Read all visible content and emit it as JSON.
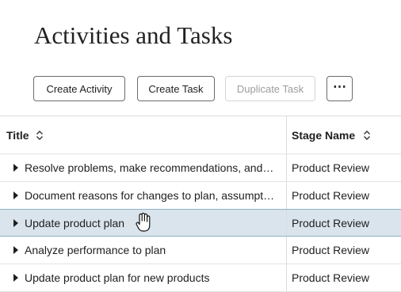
{
  "page": {
    "title": "Activities and Tasks"
  },
  "toolbar": {
    "create_activity": "Create Activity",
    "create_task": "Create Task",
    "duplicate_task": "Duplicate Task",
    "more": "⋯"
  },
  "table": {
    "columns": [
      "Title",
      "Stage Name"
    ],
    "rows": [
      {
        "title": "Resolve problems, make recommendations, and define sales goals",
        "stage": "Product Review",
        "selected": false
      },
      {
        "title": "Document reasons for changes to plan, assumptions and constraints",
        "stage": "Product Review",
        "selected": false
      },
      {
        "title": "Update product plan",
        "stage": "Product Review",
        "selected": true
      },
      {
        "title": "Analyze performance to plan",
        "stage": "Product Review",
        "selected": false
      },
      {
        "title": "Update product plan for new products",
        "stage": "Product Review",
        "selected": false
      }
    ]
  },
  "icons": {
    "sort": "sort-icon",
    "expand": "caret-right-icon",
    "cursor": "hand-pointer-icon"
  },
  "colors": {
    "selected_row": "#d9e4ec",
    "selected_border": "#8fb3c7",
    "disabled_text": "#9d9d9d"
  }
}
